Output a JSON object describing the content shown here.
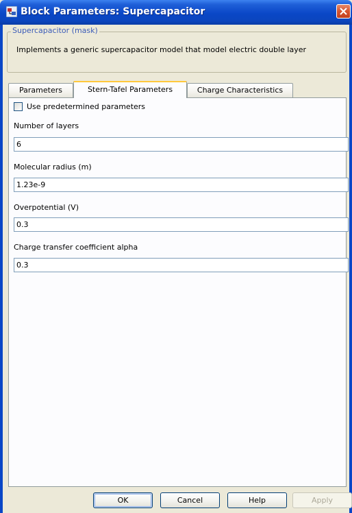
{
  "window": {
    "title": "Block Parameters: Supercapacitor"
  },
  "mask": {
    "group_label": "Supercapacitor (mask)",
    "description": "Implements a generic supercapacitor model that model electric double layer"
  },
  "tabs": [
    {
      "label": "Parameters",
      "active": false
    },
    {
      "label": "Stern-Tafel Parameters",
      "active": true
    },
    {
      "label": "Charge Characteristics",
      "active": false
    }
  ],
  "options": {
    "use_predetermined_label": "Use predetermined parameters",
    "use_predetermined_checked": false
  },
  "fields": [
    {
      "label": "Number of layers",
      "value": "6"
    },
    {
      "label": "Molecular radius (m)",
      "value": "1.23e-9"
    },
    {
      "label": "Overpotential (V)",
      "value": "0.3"
    },
    {
      "label": "Charge transfer coefficient alpha",
      "value": "0.3"
    }
  ],
  "buttons": {
    "ok": "OK",
    "cancel": "Cancel",
    "help": "Help",
    "apply": "Apply"
  },
  "colors": {
    "titlebar": "#0a47c7",
    "active_tab_accent": "#ffc83c",
    "close_button": "#d5532f",
    "group_label": "#3c5cb8"
  },
  "icons": {
    "title": "simulink-block-icon",
    "close": "close-icon"
  }
}
